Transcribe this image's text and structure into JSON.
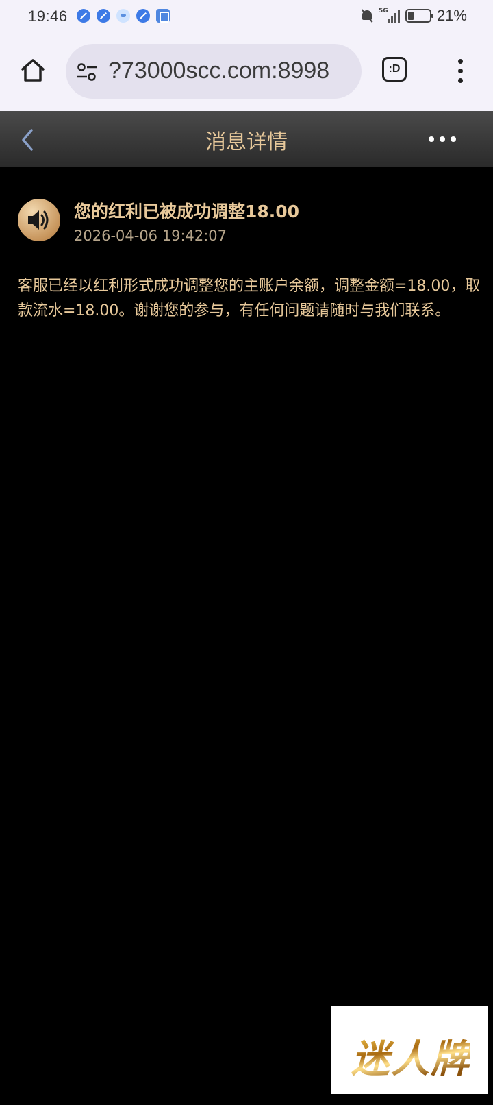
{
  "status_bar": {
    "time": "19:46",
    "network": "5G",
    "battery": "21%",
    "notification_icons": [
      "app-icon",
      "app-icon",
      "ghost-icon",
      "app-icon",
      "doc-icon"
    ]
  },
  "browser": {
    "url": "?73000scc.com:8998",
    "tab_button_label": ":D"
  },
  "header": {
    "title": "消息详情"
  },
  "message": {
    "title": "您的红利已被成功调整18.00",
    "time": "2026-04-06 19:42:07",
    "body": "客服已经以红利形式成功调整您的主账户余额，调整金额=18.00，取款流水=18.00。谢谢您的参与，有任何问题请随时与我们联系。"
  },
  "brand": {
    "logo_text": "迷人牌"
  },
  "colors": {
    "accent_gold": "#e7c89a",
    "background": "#000000",
    "header_bg": "#3a3a3a"
  }
}
